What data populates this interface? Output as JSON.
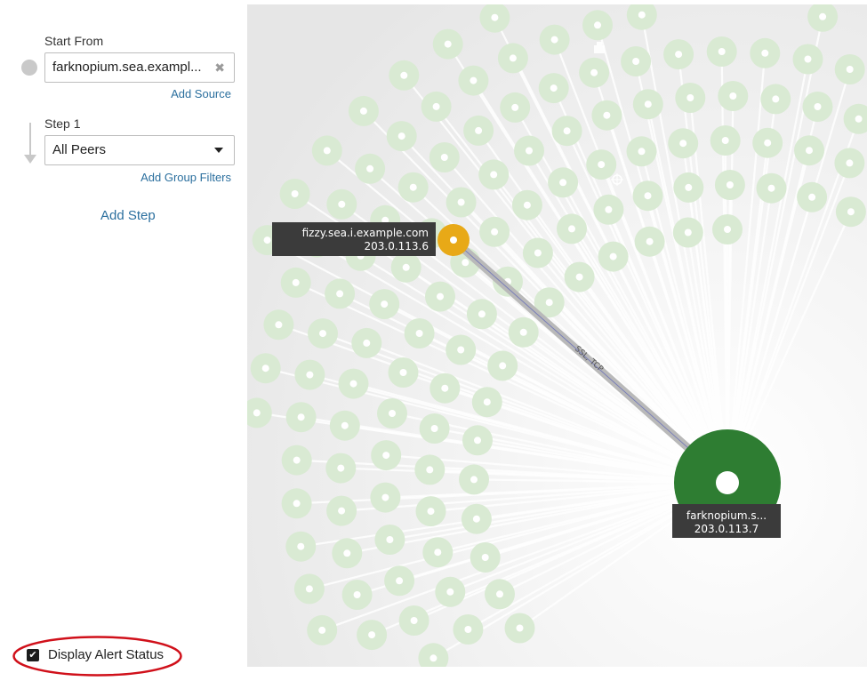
{
  "sidebar": {
    "start_from_label": "Start From",
    "source_value": "farknopium.sea.exampl...",
    "clear_glyph": "✖",
    "add_source": "Add Source",
    "step_label": "Step 1",
    "step_value": "All Peers",
    "add_group_filters": "Add Group Filters",
    "add_step": "Add Step",
    "display_alert_status": "Display Alert Status",
    "display_alert_checked": true
  },
  "graph": {
    "edge_label": "SSL, TCP",
    "peer_node": {
      "name": "fizzy.sea.i.example.com",
      "ip": "203.0.113.6",
      "color": "#e8a917"
    },
    "center_node": {
      "name": "farknopium.s...",
      "ip": "203.0.113.7",
      "color": "#2e7d32"
    },
    "icons": [
      "printer-icon",
      "crosshair-icon"
    ]
  },
  "colors": {
    "link": "#2b6f9e",
    "peer_fill": "#d9ead3",
    "annotation": "#d0101a",
    "tooltip_bg": "#3b3b3b"
  }
}
